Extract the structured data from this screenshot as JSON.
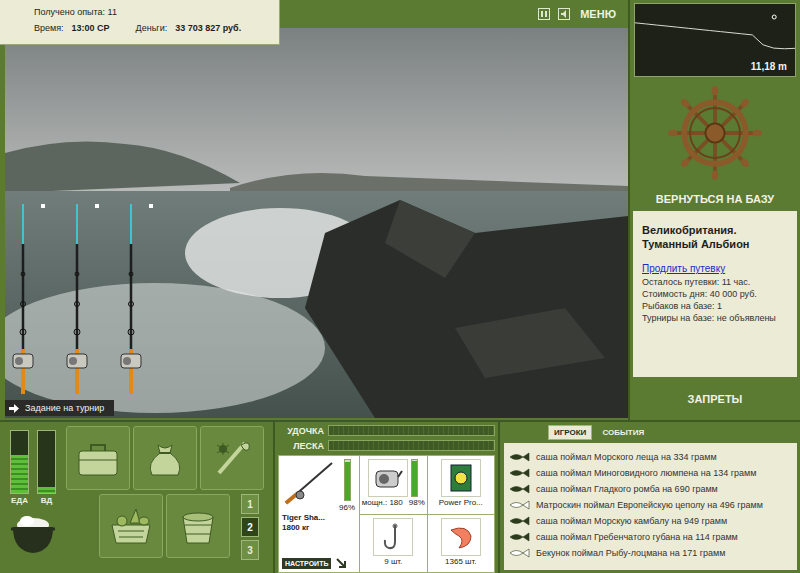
{
  "status": {
    "experience": "Получено опыта: 11",
    "time_label": "Время:",
    "time": "13:00 СР",
    "money_label": "Деньги:",
    "money": "33 703 827 руб."
  },
  "toolbar": {
    "menu": "МЕНЮ"
  },
  "scene": {
    "rods": [
      {
        "kind": "spinning"
      },
      {
        "kind": "spinning"
      },
      {
        "kind": "spinning"
      }
    ],
    "tournament_task": "Задание на турнир"
  },
  "depth_chart": {
    "reading": "11,18 m",
    "values": [
      4,
      4.5,
      5,
      5.5,
      6,
      6.5,
      7,
      7.5,
      8,
      8.5,
      9,
      9.5,
      14,
      15.5,
      15.8,
      15.6
    ],
    "marker": {
      "level": 0.87
    }
  },
  "return_button": "ВЕРНУТЬСЯ НА БАЗУ",
  "location": {
    "title": "Великобритания. Туманный Альбион",
    "link": "Продлить путевку",
    "lines": [
      "Осталось путевки: 11 час.",
      "Стоимость дня: 40 000 руб.",
      "Рыбаков на базе: 1",
      "Турниры на базе: не объявлены"
    ]
  },
  "bans": "ЗАПРЕТЫ",
  "needs": [
    {
      "label": "ЕДА",
      "level": 0.62
    },
    {
      "label": "ВД",
      "level": 0.1
    }
  ],
  "inventory": [
    {
      "kind": "tackle-box"
    },
    {
      "kind": "sack"
    },
    {
      "kind": "bait-kit"
    },
    {
      "kind": "food-basket"
    },
    {
      "kind": "bucket"
    }
  ],
  "slots": [
    {
      "label": "1",
      "selected": false
    },
    {
      "label": "2",
      "selected": true
    },
    {
      "label": "3",
      "selected": false
    }
  ],
  "tension": [
    {
      "label": "УДОЧКА",
      "level": 0
    },
    {
      "label": "ЛЕСКА",
      "level": 0
    }
  ],
  "gear": {
    "rod": {
      "name": "Tiger Sha...",
      "power": "1800 кг",
      "condition": "96%",
      "level": 0.96
    },
    "reel": {
      "power": "мощн.: 180",
      "condition": "98%",
      "level": 0.98
    },
    "line": {
      "name": "Power Pro..."
    },
    "hook": {
      "count": "9 шт."
    },
    "bait": {
      "count": "1365 шт."
    },
    "setup_button": "НАСТРОИТЬ"
  },
  "chat": {
    "tabs": [
      {
        "label": "ИГРОКИ",
        "selected": true
      },
      {
        "label": "СОБЫТИЯ",
        "selected": false
      }
    ],
    "messages": [
      {
        "text": "саша поймал Морского леща на 334 грамм",
        "color": "#2c3b1c"
      },
      {
        "text": "саша поймал Миноговидного люмпена на 134 грамм",
        "color": "#2c3b1c"
      },
      {
        "text": "саша поймал Гладкого ромба на 690 грамм",
        "color": "#2c3b1c"
      },
      {
        "text": "Матроскин поймал Европейскую цеполу на 496 грамм",
        "color": "#ffffff"
      },
      {
        "text": "саша поймал Морскую камбалу на 949 грамм",
        "color": "#2c3b1c"
      },
      {
        "text": "саша поймал Гребенчатого губана на 114 грамм",
        "color": "#2c3b1c"
      },
      {
        "text": "Бекунок поймал Рыбу-лоцмана на 171 грамм",
        "color": "#ffffff"
      }
    ]
  }
}
